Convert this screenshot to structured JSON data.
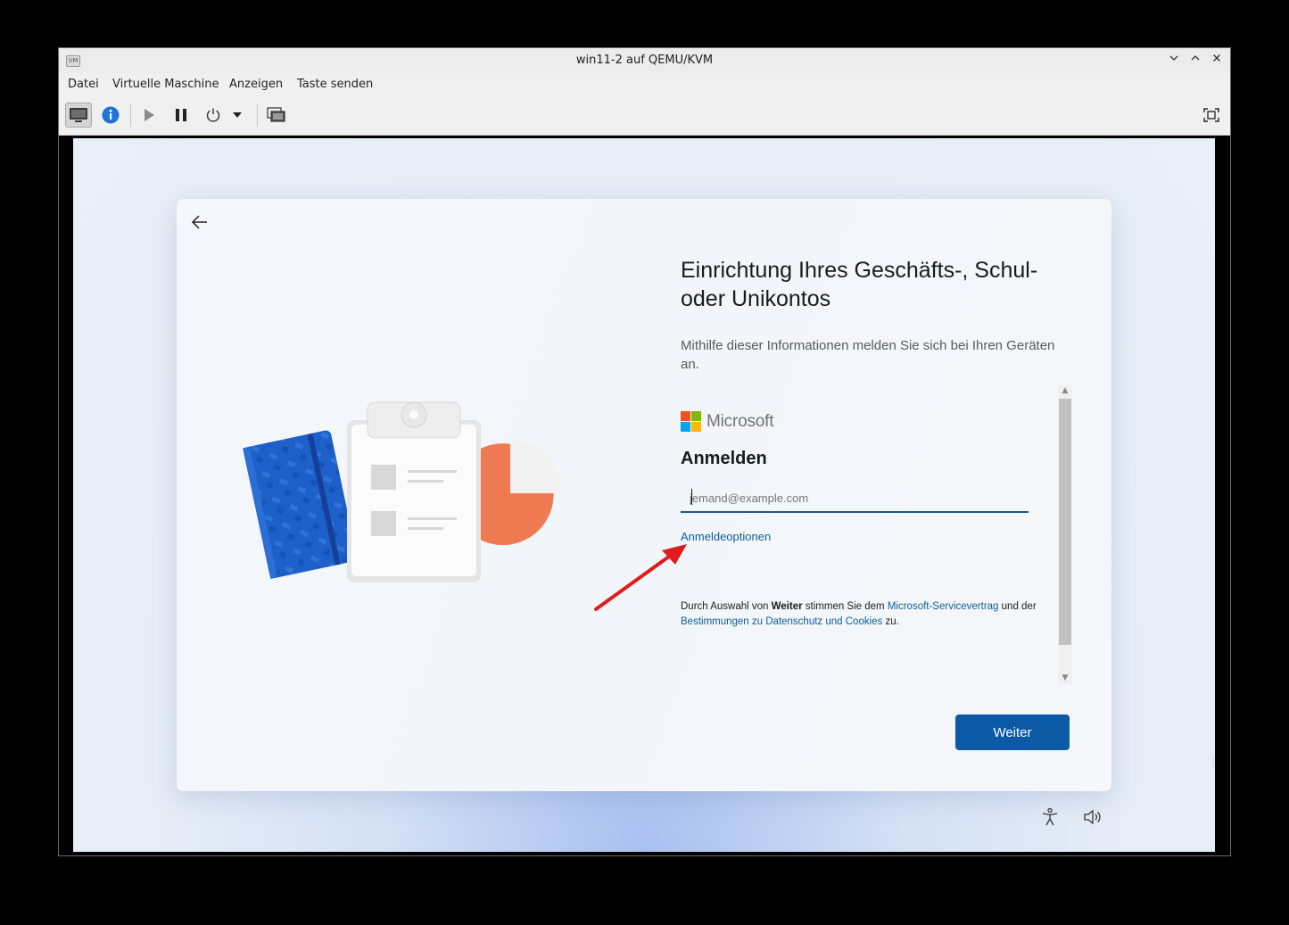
{
  "window": {
    "title": "win11-2 auf QEMU/KVM",
    "app_icon_text": "VM",
    "controls": {
      "minimize": "chevron-down",
      "maximize": "chevron-up",
      "close": "close"
    }
  },
  "menubar": {
    "items": [
      {
        "label": "Datei"
      },
      {
        "label": "Virtuelle Maschine"
      },
      {
        "label": "Anzeigen"
      },
      {
        "label": "Taste senden"
      }
    ]
  },
  "toolbar": {
    "buttons": [
      {
        "icon": "monitor-icon",
        "active": true
      },
      {
        "icon": "info-icon",
        "active": false
      },
      {
        "icon": "play-icon",
        "active": false
      },
      {
        "icon": "pause-icon",
        "active": false
      },
      {
        "icon": "power-icon",
        "active": false
      },
      {
        "icon": "dropdown-icon",
        "active": false
      },
      {
        "icon": "snapshots-icon",
        "active": false
      },
      {
        "icon": "fullscreen-icon",
        "active": false
      }
    ]
  },
  "setup": {
    "heading": "Einrichtung Ihres Geschäfts-, Schul- oder Unikontos",
    "description": "Mithilfe dieser Informationen melden Sie sich bei Ihren Geräten an.",
    "brand": "Microsoft",
    "signin_title": "Anmelden",
    "email_placeholder": "jemand@example.com",
    "email_value": "",
    "options_link": "Anmeldeoptionen",
    "terms": {
      "prefix": "Durch Auswahl von ",
      "bold": "Weiter",
      "middle": " stimmen Sie dem ",
      "link1": "Microsoft-Servicevertrag",
      "and": " und der",
      "link2": "Bestimmungen zu Datenschutz und Cookies",
      "suffix": " zu."
    },
    "next_button": "Weiter"
  },
  "colors": {
    "accent": "#0c5aa6",
    "link": "#0f5e9c",
    "annotation_arrow": "#e01b1b",
    "ms_red": "#f25022",
    "ms_green": "#7fba00",
    "ms_blue": "#00a4ef",
    "ms_yellow": "#ffb900"
  }
}
